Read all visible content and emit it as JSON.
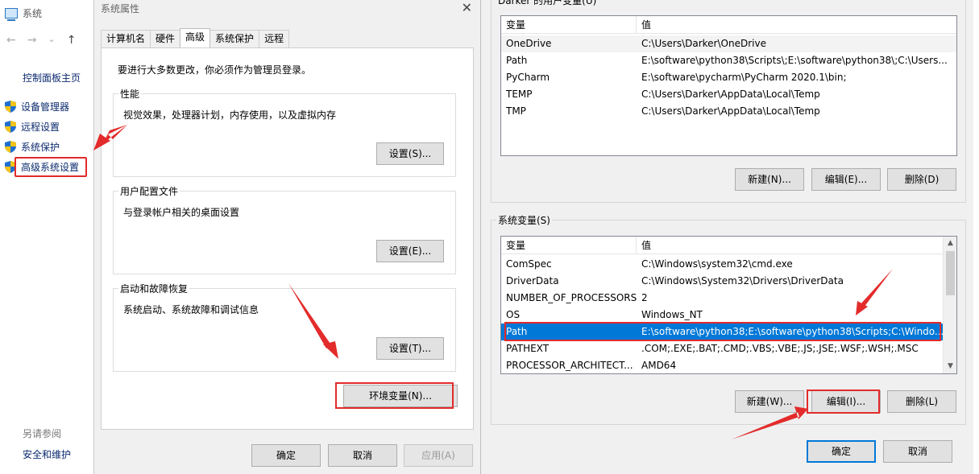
{
  "system_window": {
    "title": "系统",
    "nav": {
      "back": "←",
      "forward": "→",
      "dropdown": "⌄",
      "up": "↑"
    },
    "control_panel_home": "控制面板主页",
    "links": [
      {
        "label": "设备管理器"
      },
      {
        "label": "远程设置"
      },
      {
        "label": "系统保护"
      },
      {
        "label": "高级系统设置"
      }
    ],
    "see_also": "另请参阅",
    "security": "安全和维护"
  },
  "system_properties": {
    "title": "系统属性",
    "close": "✕",
    "tabs": [
      "计算机名",
      "硬件",
      "高级",
      "系统保护",
      "远程"
    ],
    "active_tab": "高级",
    "admin_note": "要进行大多数更改，你必须作为管理员登录。",
    "performance": {
      "label": "性能",
      "desc": "视觉效果，处理器计划，内存使用，以及虚拟内存",
      "button": "设置(S)..."
    },
    "user_profiles": {
      "label": "用户配置文件",
      "desc": "与登录帐户相关的桌面设置",
      "button": "设置(E)..."
    },
    "startup_recovery": {
      "label": "启动和故障恢复",
      "desc": "系统启动、系统故障和调试信息",
      "button": "设置(T)..."
    },
    "env_button": "环境变量(N)...",
    "ok": "确定",
    "cancel": "取消",
    "apply": "应用(A)"
  },
  "env_dialog": {
    "user_vars_label": "Darker 的用户变量(U)",
    "columns": {
      "name": "变量",
      "value": "值"
    },
    "user_vars": [
      {
        "name": "OneDrive",
        "value": "C:\\Users\\Darker\\OneDrive"
      },
      {
        "name": "Path",
        "value": "E:\\software\\python38\\Scripts\\;E:\\software\\python38\\;C:\\Users..."
      },
      {
        "name": "PyCharm",
        "value": "E:\\software\\pycharm\\PyCharm 2020.1\\bin;"
      },
      {
        "name": "TEMP",
        "value": "C:\\Users\\Darker\\AppData\\Local\\Temp"
      },
      {
        "name": "TMP",
        "value": "C:\\Users\\Darker\\AppData\\Local\\Temp"
      }
    ],
    "user_buttons": {
      "new": "新建(N)...",
      "edit": "编辑(E)...",
      "delete": "删除(D)"
    },
    "sys_vars_label": "系统变量(S)",
    "sys_vars": [
      {
        "name": "ComSpec",
        "value": "C:\\Windows\\system32\\cmd.exe"
      },
      {
        "name": "DriverData",
        "value": "C:\\Windows\\System32\\Drivers\\DriverData"
      },
      {
        "name": "NUMBER_OF_PROCESSORS",
        "value": "2"
      },
      {
        "name": "OS",
        "value": "Windows_NT"
      },
      {
        "name": "Path",
        "value": "E:\\software\\python38;E:\\software\\python38\\Scripts;C:\\Windo..."
      },
      {
        "name": "PATHEXT",
        "value": ".COM;.EXE;.BAT;.CMD;.VBS;.VBE;.JS;.JSE;.WSF;.WSH;.MSC"
      },
      {
        "name": "PROCESSOR_ARCHITECT...",
        "value": "AMD64"
      }
    ],
    "selected_sys_var": "Path",
    "sys_buttons": {
      "new": "新建(W)...",
      "edit": "编辑(I)...",
      "delete": "删除(L)"
    },
    "ok": "确定",
    "cancel": "取消",
    "scroll_up": "▲",
    "scroll_down": "▼"
  },
  "colors": {
    "highlight": "#e32b2b",
    "selection": "#0078d7",
    "link": "#0b2a6e"
  }
}
